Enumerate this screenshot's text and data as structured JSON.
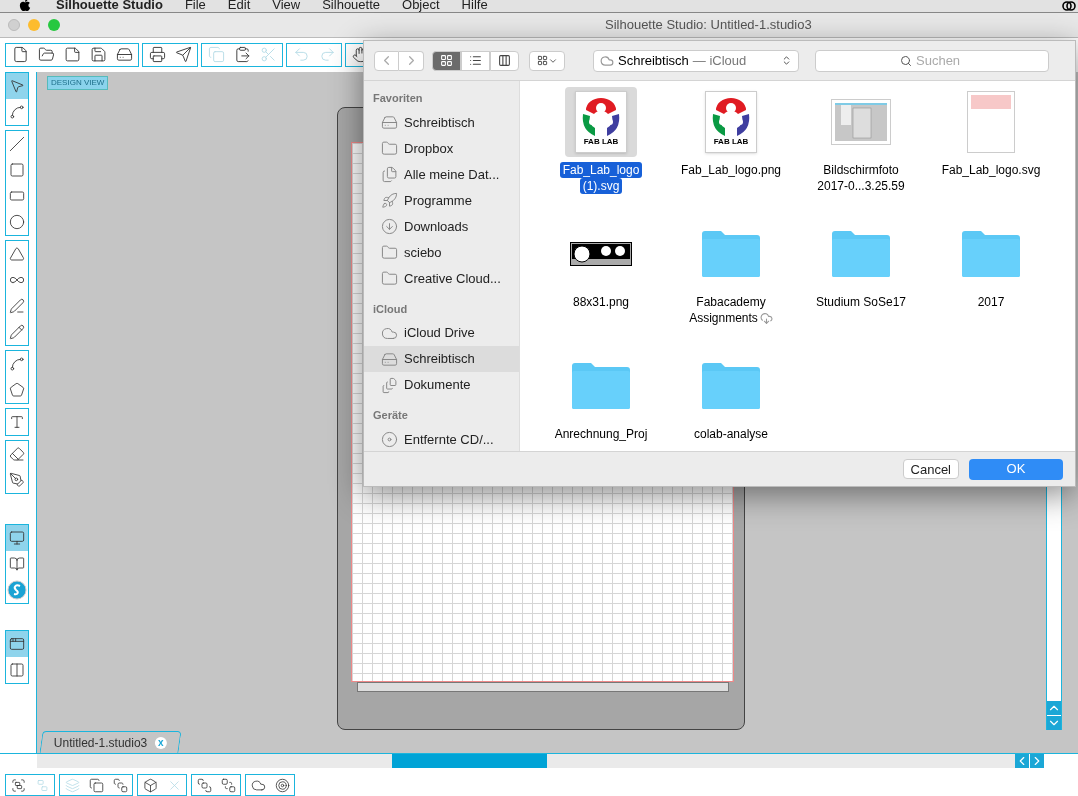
{
  "menu_bar": {
    "app": "Silhouette Studio",
    "items": [
      "File",
      "Edit",
      "View",
      "Silhouette",
      "Object",
      "Hilfe"
    ]
  },
  "window": {
    "title": "Silhouette Studio: Untitled-1.studio3"
  },
  "toolbar": [
    [
      {
        "disabled": false
      },
      {
        "disabled": false
      },
      {
        "disabled": false
      },
      {
        "disabled": false
      },
      {
        "disabled": false
      }
    ],
    [
      {
        "disabled": false
      },
      {
        "disabled": false
      }
    ],
    [
      {
        "disabled": true
      },
      {
        "disabled": false
      },
      {
        "disabled": true
      }
    ],
    [
      {
        "disabled": true
      },
      {
        "disabled": true
      }
    ],
    [
      {
        "disabled": false
      }
    ]
  ],
  "tools": [
    [
      {
        "selected": true
      },
      {
        "selected": false
      }
    ],
    [
      {
        "selected": false
      },
      {
        "selected": false
      },
      {
        "selected": false
      },
      {
        "selected": false
      }
    ],
    [
      {
        "selected": false
      },
      {
        "selected": false
      },
      {
        "selected": false
      },
      {
        "selected": false
      }
    ],
    [
      {
        "selected": false
      },
      {
        "selected": false
      }
    ],
    [
      {
        "selected": false
      }
    ],
    [
      {
        "selected": false
      },
      {
        "selected": false
      }
    ],
    [
      {
        "selected": true
      },
      {
        "selected": false
      },
      {
        "selected": false
      }
    ],
    [
      {
        "selected": true
      },
      {
        "selected": false
      }
    ]
  ],
  "canvas": {
    "view_label": "DESIGN VIEW"
  },
  "document_tab": {
    "label": "Untitled-1.studio3",
    "close": "x"
  },
  "bottom_toolbar": [
    [
      {
        "disabled": false
      },
      {
        "disabled": true
      }
    ],
    [
      {
        "disabled": true
      },
      {
        "disabled": false
      },
      {
        "disabled": false
      }
    ],
    [
      {
        "disabled": false
      },
      {
        "disabled": true
      }
    ],
    [
      {
        "disabled": false
      },
      {
        "disabled": false
      }
    ],
    [
      {
        "disabled": false
      },
      {
        "disabled": false
      }
    ]
  ],
  "dialog": {
    "view_modes": [
      {
        "selected": true
      },
      {
        "selected": false
      },
      {
        "selected": false
      }
    ],
    "location": {
      "name": "Schreibtisch",
      "suffix": "— iCloud"
    },
    "search": {
      "placeholder": "Suchen"
    },
    "sidebar": [
      {
        "title": "Favoriten",
        "items": [
          {
            "label": "Schreibtisch",
            "selected": false
          },
          {
            "label": "Dropbox",
            "selected": false
          },
          {
            "label": "Alle meine Dat...",
            "selected": false
          },
          {
            "label": "Programme",
            "selected": false
          },
          {
            "label": "Downloads",
            "selected": false
          },
          {
            "label": "sciebo",
            "selected": false
          },
          {
            "label": "Creative Cloud...",
            "selected": false
          }
        ]
      },
      {
        "title": "iCloud",
        "items": [
          {
            "label": "iCloud Drive",
            "selected": false
          },
          {
            "label": "Schreibtisch",
            "selected": true
          },
          {
            "label": "Dokumente",
            "selected": false
          }
        ]
      },
      {
        "title": "Geräte",
        "items": [
          {
            "label": "Entfernte CD/...",
            "selected": false
          }
        ]
      }
    ],
    "files": [
      {
        "kind": "logo",
        "thumb_text": "FAB LAB",
        "lines": [
          "Fab_Lab_logo",
          "(1).svg"
        ],
        "selected": true,
        "cloud": false
      },
      {
        "kind": "logo",
        "thumb_text": "FAB LAB",
        "lines": [
          "Fab_Lab_logo.png"
        ],
        "selected": false,
        "cloud": false
      },
      {
        "kind": "screenshot",
        "lines": [
          "Bildschirmfoto",
          "2017-0...3.25.59"
        ],
        "selected": false,
        "cloud": false
      },
      {
        "kind": "document",
        "lines": [
          "Fab_Lab_logo.svg"
        ],
        "selected": false,
        "cloud": false
      },
      {
        "kind": "badge",
        "lines": [
          "88x31.png"
        ],
        "selected": false,
        "cloud": false
      },
      {
        "kind": "folder",
        "lines": [
          "Fabacademy",
          "Assignments"
        ],
        "selected": false,
        "cloud": true
      },
      {
        "kind": "folder",
        "lines": [
          "Studium SoSe17"
        ],
        "selected": false,
        "cloud": false
      },
      {
        "kind": "folder",
        "lines": [
          "2017"
        ],
        "selected": false,
        "cloud": false
      },
      {
        "kind": "folder",
        "lines": [
          "Anrechnung_Proj"
        ],
        "selected": false,
        "cloud": false
      },
      {
        "kind": "folder",
        "lines": [
          "colab-analyse"
        ],
        "selected": false,
        "cloud": false
      }
    ],
    "buttons": {
      "cancel": "Cancel",
      "ok": "OK"
    }
  }
}
